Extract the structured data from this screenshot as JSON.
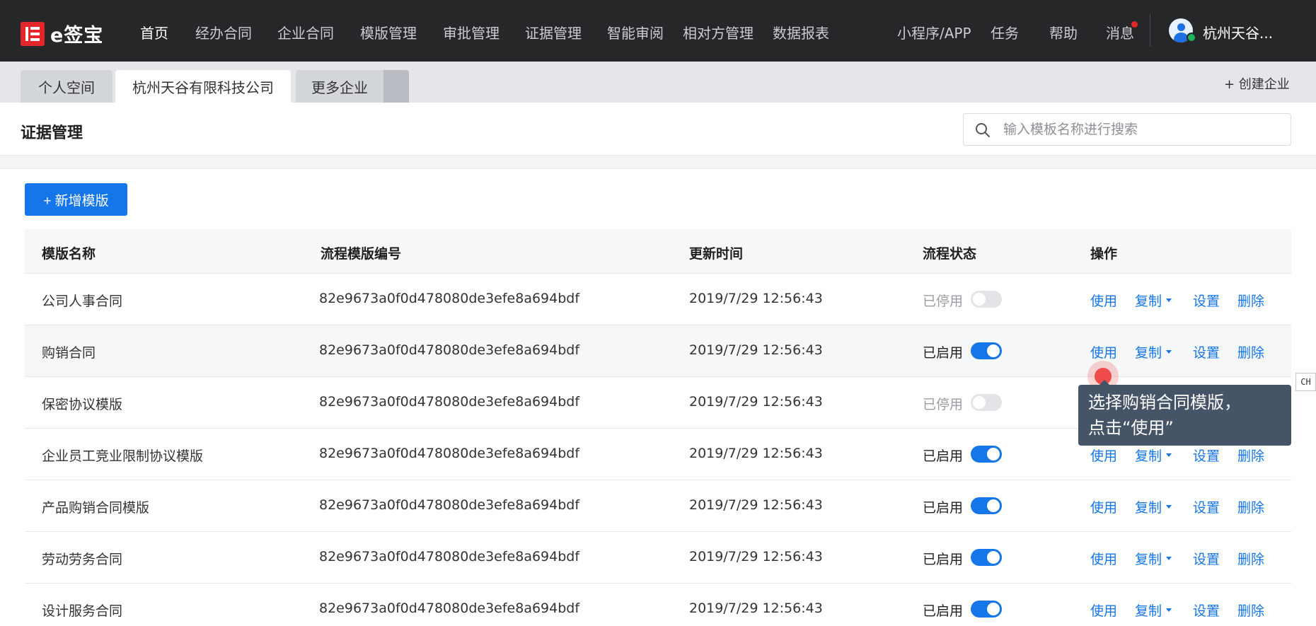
{
  "brand": {
    "name": "e签宝"
  },
  "nav": {
    "items": [
      "首页",
      "经办合同",
      "企业合同",
      "模版管理",
      "审批管理",
      "证据管理",
      "智能审阅",
      "相对方管理",
      "数据报表"
    ],
    "right": [
      "小程序/APP",
      "任务",
      "帮助",
      "消息"
    ],
    "user": "杭州天谷..."
  },
  "tabs": [
    "个人空间",
    "杭州天谷有限科技公司",
    "更多企业"
  ],
  "create_enterprise": "+ 创建企业",
  "page": {
    "title": "证据管理",
    "search_placeholder": "输入模板名称进行搜索",
    "add_button": "+ 新增模版"
  },
  "table": {
    "headers": [
      "模版名称",
      "流程模版编号",
      "更新时间",
      "流程状态",
      "操作"
    ],
    "rows": [
      {
        "name": "公司人事合同",
        "id": "82e9673a0f0d478080de3efe8a694bdf",
        "time": "2019/7/29 12:56:43",
        "status": "已停用",
        "enabled": false
      },
      {
        "name": "购销合同",
        "id": "82e9673a0f0d478080de3efe8a694bdf",
        "time": "2019/7/29 12:56:43",
        "status": "已启用",
        "enabled": true
      },
      {
        "name": "保密协议模版",
        "id": "82e9673a0f0d478080de3efe8a694bdf",
        "time": "2019/7/29 12:56:43",
        "status": "已停用",
        "enabled": false
      },
      {
        "name": "企业员工竞业限制协议模版",
        "id": "82e9673a0f0d478080de3efe8a694bdf",
        "time": "2019/7/29 12:56:43",
        "status": "已启用",
        "enabled": true
      },
      {
        "name": "产品购销合同模版",
        "id": "82e9673a0f0d478080de3efe8a694bdf",
        "time": "2019/7/29 12:56:43",
        "status": "已启用",
        "enabled": true
      },
      {
        "name": "劳动劳务合同",
        "id": "82e9673a0f0d478080de3efe8a694bdf",
        "time": "2019/7/29 12:56:43",
        "status": "已启用",
        "enabled": true
      },
      {
        "name": "设计服务合同",
        "id": "82e9673a0f0d478080de3efe8a694bdf",
        "time": "2019/7/29 12:56:43",
        "status": "已启用",
        "enabled": true
      }
    ],
    "actions": [
      "使用",
      "复制",
      "设置",
      "删除"
    ]
  },
  "tooltip": {
    "line1": "选择购销合同模版，",
    "line2": "点击“使用”"
  },
  "ime_indicator": "CH",
  "colors": {
    "accent": "#1476e8",
    "nav_bg": "#262729",
    "brand_red": "#e4262b",
    "tooltip_bg": "#465468"
  }
}
